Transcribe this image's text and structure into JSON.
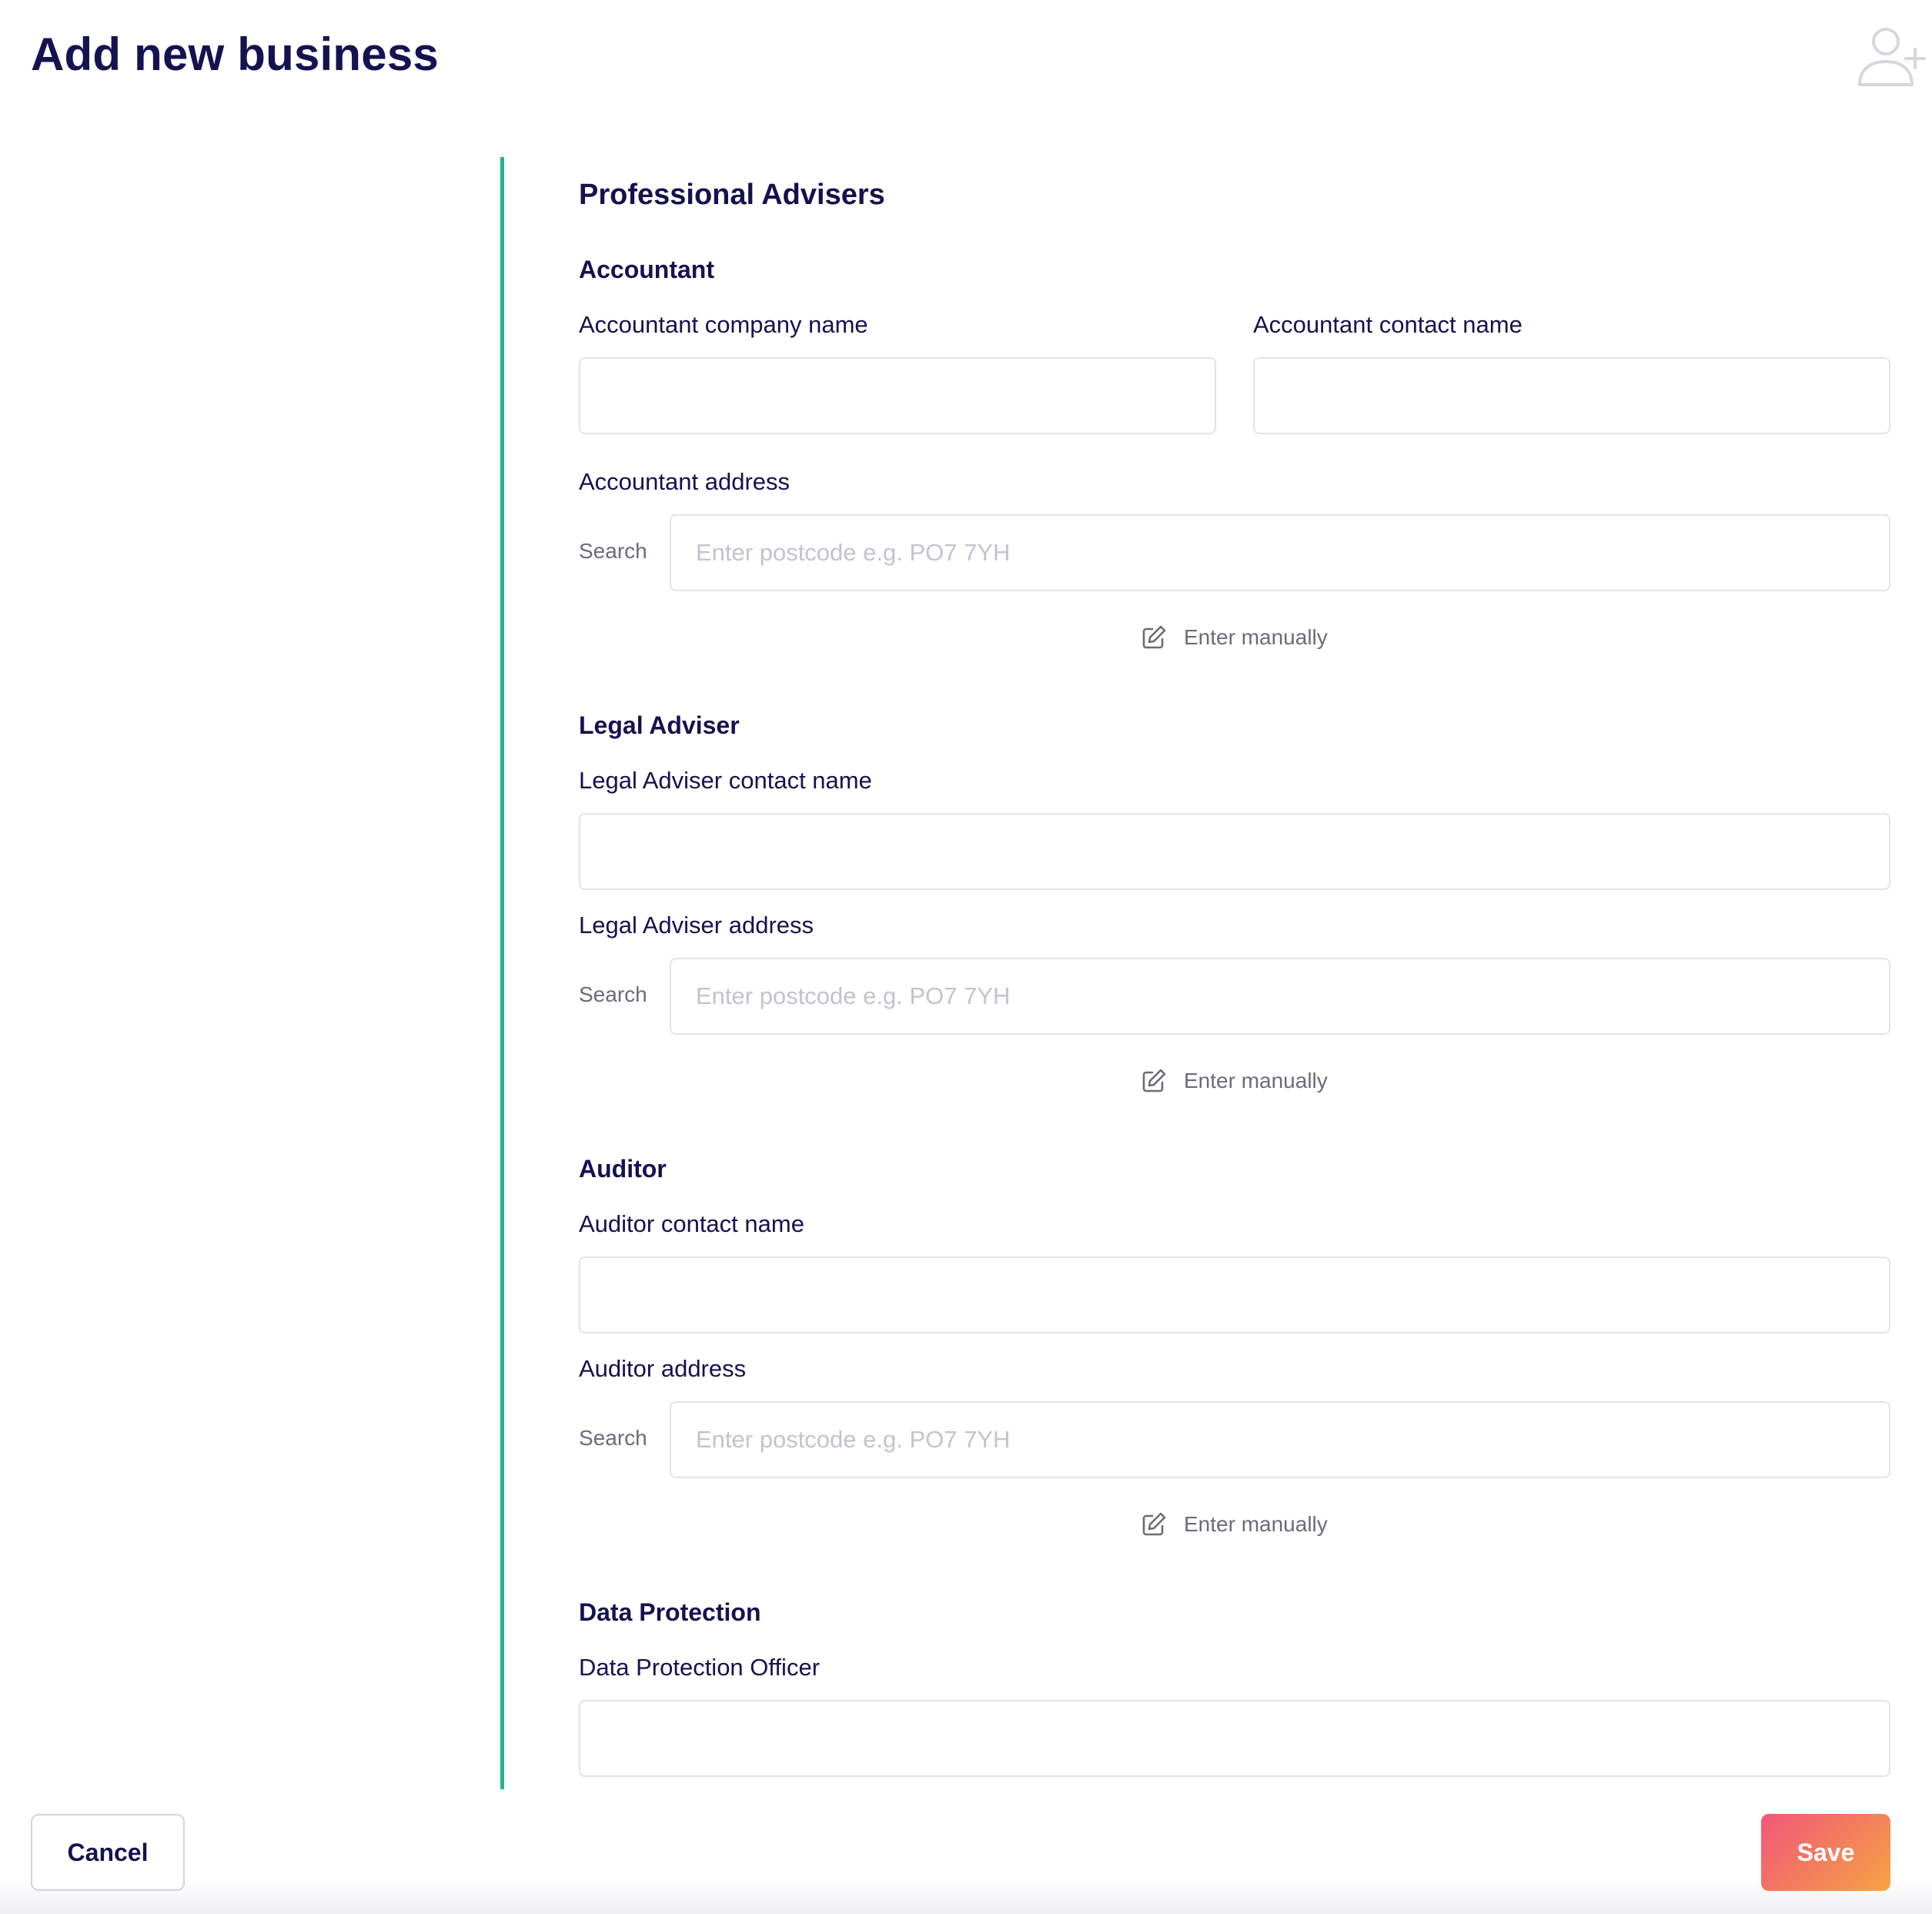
{
  "page": {
    "title": "Add new business"
  },
  "header_icon": "user-add-icon",
  "section": {
    "title": "Professional Advisers"
  },
  "accountant": {
    "title": "Accountant",
    "company_label": "Accountant company name",
    "company_value": "",
    "contact_label": "Accountant contact name",
    "contact_value": "",
    "address_label": "Accountant address",
    "search_label": "Search",
    "search_placeholder": "Enter postcode e.g. PO7 7YH",
    "manual_label": "Enter manually"
  },
  "legal": {
    "title": "Legal Adviser",
    "contact_label": "Legal Adviser contact name",
    "contact_value": "",
    "address_label": "Legal Adviser address",
    "search_label": "Search",
    "search_placeholder": "Enter postcode e.g. PO7 7YH",
    "manual_label": "Enter manually"
  },
  "auditor": {
    "title": "Auditor",
    "contact_label": "Auditor contact name",
    "contact_value": "",
    "address_label": "Auditor address",
    "search_label": "Search",
    "search_placeholder": "Enter postcode e.g. PO7 7YH",
    "manual_label": "Enter manually"
  },
  "data_protection": {
    "title": "Data Protection",
    "officer_label": "Data Protection Officer",
    "officer_value": ""
  },
  "footer": {
    "cancel_label": "Cancel",
    "save_label": "Save"
  },
  "colors": {
    "text": "#14124f",
    "accent_rule": "#21b38f",
    "save_gradient_start": "#f0577a",
    "save_gradient_end": "#f6a244",
    "muted": "#6b6b7b",
    "border": "#e3e3e8"
  }
}
